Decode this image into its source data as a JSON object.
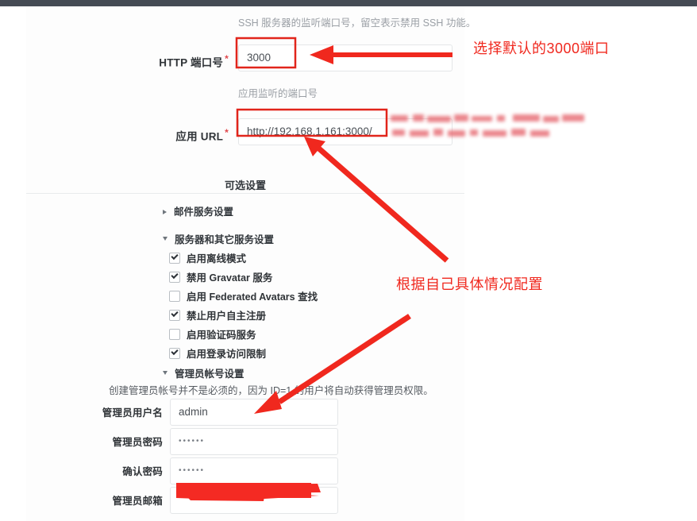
{
  "window": {
    "titlebar_color": "#454b54"
  },
  "colors": {
    "annotation_red": "#f0281e",
    "highlight_red": "#e1251b",
    "required_red": "#e0484c",
    "redaction_red": "#f42a23"
  },
  "form": {
    "ssh_help": "SSH 服务器的监听端口号，留空表示禁用 SSH 功能。",
    "http_port": {
      "label": "HTTP 端口号",
      "required_mark": "*",
      "value": "3000",
      "help": "应用监听的端口号"
    },
    "app_url": {
      "label": "应用 URL",
      "required_mark": "*",
      "value": "http://192.168.1.161:3000/",
      "help": ""
    }
  },
  "optional": {
    "header": "可选设置",
    "groups": [
      {
        "label": "邮件服务设置",
        "state": "collapsed"
      },
      {
        "label": "服务器和其它服务设置",
        "state": "expanded"
      },
      {
        "label": "管理员帐号设置",
        "state": "expanded"
      }
    ],
    "checkboxes": [
      {
        "label": "启用离线模式",
        "checked": true
      },
      {
        "label": "禁用 Gravatar 服务",
        "checked": true
      },
      {
        "label": "启用 Federated Avatars 查找",
        "checked": false
      },
      {
        "label": "禁止用户自主注册",
        "checked": true
      },
      {
        "label": "启用验证码服务",
        "checked": false
      },
      {
        "label": "启用登录访问限制",
        "checked": true
      }
    ],
    "admin_note": "创建管理员帐号并不是必须的，因为 ID=1 的用户将自动获得管理员权限。",
    "admin_fields": [
      {
        "label": "管理员用户名",
        "value": "admin",
        "masked": false,
        "redacted": false
      },
      {
        "label": "管理员密码",
        "value": "••••••",
        "masked": true,
        "redacted": false
      },
      {
        "label": "确认密码",
        "value": "••••••",
        "masked": true,
        "redacted": false
      },
      {
        "label": "管理员邮箱",
        "value": "",
        "masked": false,
        "redacted": true
      }
    ]
  },
  "annotations": [
    {
      "text": "选择默认的3000端口",
      "kind": "callout-text"
    },
    {
      "text": "根据自己具体情况配置",
      "kind": "callout-text"
    }
  ]
}
